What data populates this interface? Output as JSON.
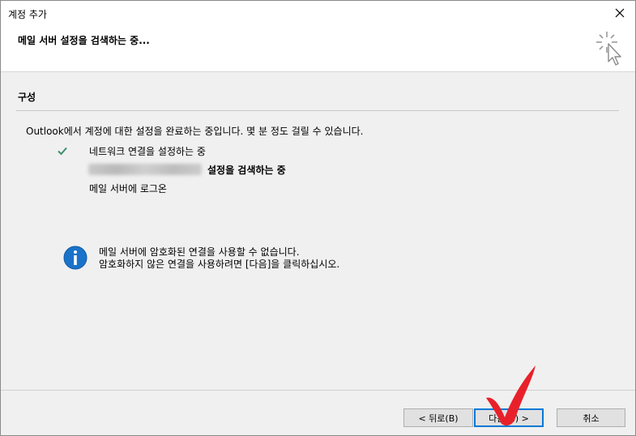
{
  "window": {
    "title": "계정 추가"
  },
  "header": {
    "title": "메일 서버 설정을 검색하는 중..."
  },
  "section": {
    "title": "구성"
  },
  "intro": "Outlook에서 계정에 대한 설정을 완료하는 중입니다. 몇 분 정도 걸릴 수 있습니다.",
  "steps": [
    {
      "label": "네트워크 연결을 설정하는 중",
      "status": "done"
    },
    {
      "label": "설정을 검색하는 중",
      "status": "in-progress"
    },
    {
      "label": "메일 서버에 로그온",
      "status": "pending"
    }
  ],
  "info": {
    "line1": "메일 서버에 암호화된 연결을 사용할 수 없습니다.",
    "line2": "암호화하지 않은 연결을 사용하려면 [다음]을 클릭하십시오."
  },
  "buttons": {
    "back": "< 뒤로(B)",
    "next": "다음(N) >",
    "cancel": "취소"
  },
  "colors": {
    "accent": "#0078d7",
    "check": "#3f8f6b",
    "info": "#1a73c9",
    "annotation": "#e8202a"
  },
  "icons": [
    "close-icon",
    "cursor-click-icon",
    "checkmark-icon",
    "info-icon",
    "red-checkmark-annotation"
  ]
}
